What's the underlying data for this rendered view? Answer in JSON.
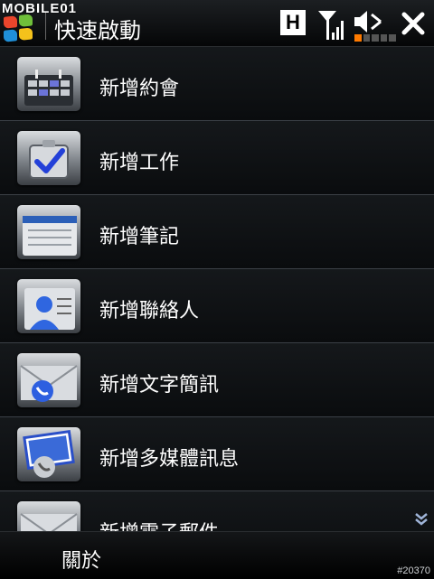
{
  "watermark": "MOBILE01",
  "title": "快速啟動",
  "status": {
    "network_type": "H",
    "battery_segments_on": 1,
    "battery_segments_total": 5,
    "battery_color": "#ff7a00"
  },
  "menu_items": [
    {
      "label": "新增約會",
      "icon": "calendar-icon"
    },
    {
      "label": "新增工作",
      "icon": "task-check-icon"
    },
    {
      "label": "新增筆記",
      "icon": "notes-icon"
    },
    {
      "label": "新增聯絡人",
      "icon": "contact-icon"
    },
    {
      "label": "新增文字簡訊",
      "icon": "sms-icon"
    },
    {
      "label": "新增多媒體訊息",
      "icon": "mms-icon"
    },
    {
      "label": "新增電子郵件",
      "icon": "email-icon"
    }
  ],
  "softkeys": {
    "left": "關於"
  },
  "post_id": "#20370"
}
